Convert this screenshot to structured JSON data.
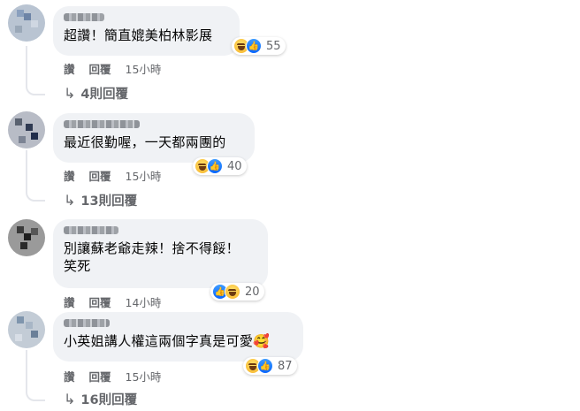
{
  "comments": [
    {
      "text": "超讚！簡直媲美柏林影展",
      "reactions": [
        "haha",
        "like"
      ],
      "reaction_count": "55",
      "actions": {
        "like": "讚",
        "reply": "回覆",
        "time": "15小時"
      },
      "replies": "4則回覆"
    },
    {
      "text": "最近很勤喔，一天都兩團的",
      "reactions": [
        "haha",
        "like"
      ],
      "reaction_count": "40",
      "actions": {
        "like": "讚",
        "reply": "回覆",
        "time": "15小時"
      },
      "replies": "13則回覆"
    },
    {
      "text": "別讓蘇老爺走辣！捨不得餒！\n笑死",
      "reactions": [
        "like",
        "haha"
      ],
      "reaction_count": "20",
      "actions": {
        "like": "讚",
        "reply": "回覆",
        "time": "14小時"
      },
      "replies": ""
    },
    {
      "text": "小英姐講人權這兩個字真是可愛🥰",
      "reactions": [
        "haha",
        "like"
      ],
      "reaction_count": "87",
      "actions": {
        "like": "讚",
        "reply": "回覆",
        "time": "15小時"
      },
      "replies": "16則回覆"
    }
  ],
  "colors": {
    "bubble": "#f0f2f5",
    "meta": "#65676b",
    "like_blue": "#0866ff",
    "haha_yellow": "#f7b125"
  }
}
